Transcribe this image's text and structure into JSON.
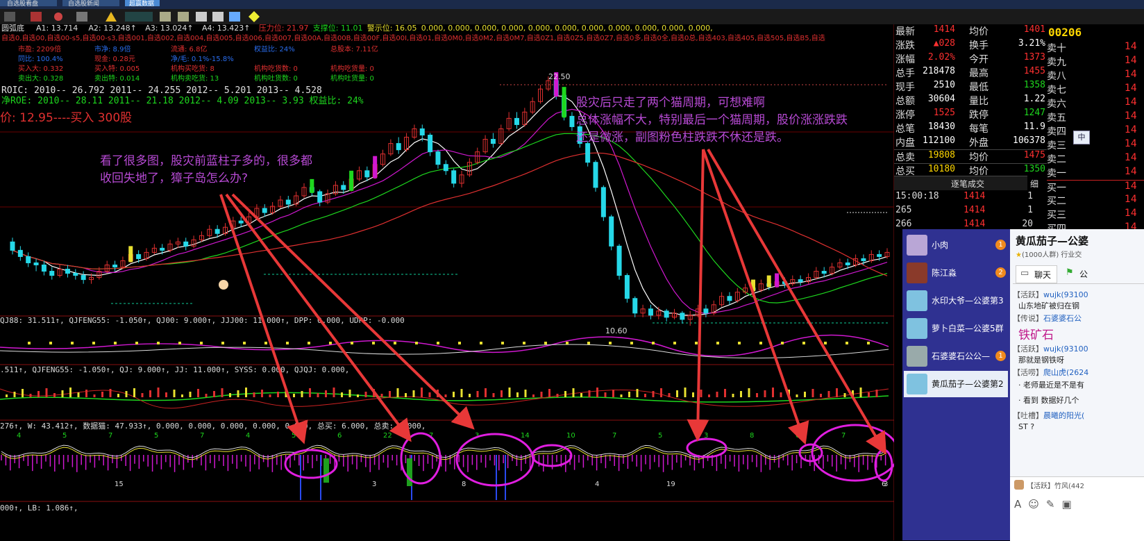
{
  "toolbar": {
    "tabs": [
      "自选股看盘",
      "自选股新闻",
      "超赢数据"
    ],
    "icons": [
      "layout-icon",
      "chart-icon",
      "signal-icon",
      "alarm-icon",
      "stats-icon",
      "drawing-icon",
      "text-icon",
      "chart2-icon",
      "help-icon"
    ]
  },
  "chart_data": {
    "type": "candlestick",
    "indicator_top": {
      "name": "圆弧底",
      "items": [
        {
          "label": "A1:",
          "value": "13.714"
        },
        {
          "label": "A2:",
          "value": "13.248↑"
        },
        {
          "label": "A3:",
          "value": "13.024↑"
        },
        {
          "label": "A4:",
          "value": "13.423↑"
        },
        {
          "label": "压力位:",
          "value": "21.97"
        },
        {
          "label": "支撑位:",
          "value": "11.01"
        },
        {
          "label": "警示位:",
          "value": "16.05"
        },
        {
          "label": "",
          "value": "0.000, 0.000, 0.000, 0.000, 0.000, 0.000, 0.000, 0.000, 0.000, 0.000, 0.000,"
        }
      ]
    },
    "selection_line": "自选0,自选00,自选00-s5,自选00-s3,自选001,自选002,自选004,自选005,自选006,自选007,自选00A,自选00B,自选00F,自选00I,自选01,自选0M0,自选0M2,自选0M7,自选0Z1,自选0Z5,自选0Z7,自选0多,自选0全,自选0总,自选403,自选405,自选505,自选B5,自选",
    "fundamentals": [
      [
        "市盈: 2209倍",
        "市净: 8.9倍",
        "流通: 6.8亿",
        "权益比: 24%",
        "总股本: 7.11亿"
      ],
      [
        "同比: 100.4%",
        "现金: 0.28元",
        "净/毛: 0.1%-15.8%"
      ],
      [
        "买入大: 0.332",
        "买入特: 0.005",
        "机构买吃货: 8",
        "机构吃货数: 0",
        "机构吃货量: 0"
      ],
      [
        "卖出大: 0.328",
        "卖出特: 0.014",
        "机构卖吃货: 13",
        "机构吐货数: 0",
        "机构吐货量: 0"
      ]
    ],
    "roic": "ROIC: 2010-- 26.792    2011-- 24.255    2012-- 5.201    2013-- 4.528",
    "roe": "净ROE: 2010-- 28.11     2011-- 21.18     2012-- 4.09     2013-- 3.93     权益比: 24%",
    "buy_note": "价: 12.95----买入 300股",
    "price_high": "22.50",
    "price_low": "10.60",
    "candles": [
      [
        14.6,
        14.2,
        14.8,
        14.0
      ],
      [
        14.2,
        13.9,
        14.4,
        13.7
      ],
      [
        13.9,
        13.6,
        14.1,
        13.4
      ],
      [
        13.6,
        13.5,
        13.8,
        13.2
      ],
      [
        13.5,
        13.2,
        13.7,
        13.0
      ],
      [
        13.2,
        13.0,
        13.4,
        12.8
      ],
      [
        13.0,
        13.3,
        13.5,
        12.9
      ],
      [
        13.3,
        13.1,
        13.5,
        12.9
      ],
      [
        13.1,
        13.0,
        13.3,
        12.8
      ],
      [
        13.0,
        12.8,
        13.2,
        12.6
      ],
      [
        12.8,
        12.9,
        13.1,
        12.6
      ],
      [
        12.9,
        13.2,
        13.4,
        12.8
      ],
      [
        13.2,
        13.5,
        13.7,
        13.1
      ],
      [
        13.5,
        13.4,
        13.7,
        13.2
      ],
      [
        13.4,
        13.7,
        13.9,
        13.3
      ],
      [
        13.7,
        14.0,
        14.2,
        13.6
      ],
      [
        14.0,
        13.8,
        14.2,
        13.6
      ],
      [
        13.8,
        14.1,
        14.3,
        13.7
      ],
      [
        14.1,
        14.3,
        14.5,
        14.0
      ],
      [
        14.3,
        14.2,
        14.5,
        14.0
      ],
      [
        14.2,
        14.5,
        14.7,
        14.1
      ],
      [
        14.5,
        14.6,
        14.8,
        14.3
      ],
      [
        14.6,
        14.4,
        14.8,
        14.2
      ],
      [
        14.4,
        14.7,
        14.9,
        14.3
      ],
      [
        14.7,
        14.9,
        15.1,
        14.6
      ],
      [
        14.9,
        15.2,
        15.4,
        14.8
      ],
      [
        15.2,
        15.0,
        15.4,
        14.8
      ],
      [
        15.0,
        15.3,
        15.5,
        14.9
      ],
      [
        15.3,
        15.6,
        15.8,
        15.2
      ],
      [
        15.6,
        15.5,
        15.8,
        15.3
      ],
      [
        15.5,
        15.8,
        16.0,
        15.4
      ],
      [
        15.8,
        16.2,
        16.4,
        15.7
      ],
      [
        16.2,
        16.0,
        16.4,
        15.8
      ],
      [
        16.0,
        16.3,
        16.5,
        15.9
      ],
      [
        16.3,
        16.6,
        16.8,
        16.2
      ],
      [
        16.6,
        16.4,
        16.8,
        16.2
      ],
      [
        16.4,
        16.8,
        17.0,
        16.3
      ],
      [
        16.8,
        17.2,
        17.4,
        16.7
      ],
      [
        17.2,
        17.0,
        17.4,
        16.8
      ],
      [
        17.0,
        16.5,
        17.1,
        16.3
      ],
      [
        16.5,
        16.9,
        17.1,
        16.4
      ],
      [
        16.9,
        17.3,
        17.5,
        16.8
      ],
      [
        17.3,
        17.1,
        17.5,
        16.9
      ],
      [
        17.1,
        17.6,
        17.8,
        17.0
      ],
      [
        17.6,
        18.0,
        18.2,
        17.5
      ],
      [
        18.0,
        17.7,
        18.2,
        17.5
      ],
      [
        17.7,
        18.3,
        18.5,
        17.6
      ],
      [
        18.3,
        18.8,
        19.0,
        18.2
      ],
      [
        18.8,
        19.3,
        19.5,
        18.7
      ],
      [
        19.3,
        19.0,
        19.6,
        18.8
      ],
      [
        19.0,
        19.6,
        19.8,
        18.9
      ],
      [
        19.6,
        20.0,
        20.2,
        19.5
      ],
      [
        20.0,
        19.7,
        20.2,
        19.4
      ],
      [
        19.7,
        18.9,
        19.8,
        18.7
      ],
      [
        18.9,
        18.3,
        19.0,
        18.1
      ],
      [
        18.3,
        18.0,
        18.5,
        17.8
      ],
      [
        18.0,
        17.4,
        18.1,
        17.2
      ],
      [
        17.4,
        17.8,
        18.0,
        17.2
      ],
      [
        17.8,
        18.4,
        18.6,
        17.7
      ],
      [
        18.4,
        18.9,
        19.1,
        18.3
      ],
      [
        18.9,
        19.5,
        19.7,
        18.8
      ],
      [
        19.5,
        19.3,
        19.8,
        19.1
      ],
      [
        19.3,
        20.0,
        20.2,
        19.2
      ],
      [
        20.0,
        20.5,
        20.8,
        19.9
      ],
      [
        20.5,
        20.2,
        20.8,
        20.0
      ],
      [
        20.2,
        20.8,
        21.0,
        20.1
      ],
      [
        20.8,
        21.3,
        21.5,
        20.7
      ],
      [
        21.3,
        21.9,
        22.1,
        21.2
      ],
      [
        21.9,
        22.3,
        22.5,
        21.8
      ],
      [
        22.3,
        21.6,
        22.5,
        21.4
      ],
      [
        21.6,
        20.6,
        21.7,
        20.4
      ],
      [
        20.6,
        20.1,
        20.8,
        19.9
      ],
      [
        20.1,
        19.3,
        20.2,
        19.1
      ],
      [
        19.3,
        18.4,
        19.4,
        18.2
      ],
      [
        18.4,
        17.2,
        18.5,
        17.0
      ],
      [
        17.2,
        15.8,
        17.3,
        15.6
      ],
      [
        15.8,
        14.4,
        15.9,
        14.2
      ],
      [
        14.4,
        13.0,
        14.5,
        12.8
      ],
      [
        13.0,
        11.9,
        13.1,
        11.7
      ],
      [
        11.9,
        11.2,
        12.0,
        11.0
      ],
      [
        11.2,
        11.4,
        11.6,
        11.0
      ],
      [
        11.4,
        11.1,
        11.6,
        10.9
      ],
      [
        11.1,
        11.3,
        11.5,
        10.9
      ],
      [
        11.3,
        11.0,
        11.4,
        10.8
      ],
      [
        11.0,
        11.2,
        11.4,
        10.9
      ],
      [
        11.2,
        10.9,
        11.3,
        10.7
      ],
      [
        10.9,
        11.1,
        11.3,
        10.6
      ],
      [
        11.1,
        11.4,
        11.6,
        11.0
      ],
      [
        11.4,
        11.2,
        11.6,
        11.0
      ],
      [
        11.2,
        11.6,
        11.8,
        11.1
      ],
      [
        11.6,
        12.0,
        12.2,
        11.5
      ],
      [
        12.0,
        11.8,
        12.2,
        11.6
      ],
      [
        11.8,
        12.2,
        12.4,
        11.7
      ],
      [
        12.2,
        12.4,
        12.6,
        12.1
      ],
      [
        12.4,
        12.3,
        12.6,
        12.1
      ],
      [
        12.3,
        12.6,
        12.8,
        12.2
      ],
      [
        12.6,
        12.5,
        12.8,
        12.3
      ],
      [
        12.5,
        12.7,
        12.9,
        12.4
      ],
      [
        12.7,
        12.6,
        12.9,
        12.4
      ],
      [
        12.6,
        12.8,
        13.0,
        12.5
      ],
      [
        12.8,
        12.7,
        13.0,
        12.5
      ],
      [
        12.7,
        12.9,
        13.1,
        12.6
      ],
      [
        12.9,
        13.2,
        13.4,
        12.8
      ],
      [
        13.2,
        13.1,
        13.4,
        12.9
      ],
      [
        13.1,
        13.4,
        13.6,
        13.0
      ],
      [
        13.4,
        13.6,
        13.8,
        13.3
      ],
      [
        13.6,
        13.5,
        13.8,
        13.3
      ],
      [
        13.5,
        13.8,
        14.0,
        13.4
      ],
      [
        13.8,
        13.7,
        14.0,
        13.5
      ],
      [
        13.7,
        14.0,
        14.2,
        13.6
      ],
      [
        14.0,
        13.9,
        14.2,
        13.7
      ],
      [
        13.9,
        14.1,
        14.3,
        13.8
      ]
    ],
    "annotations": {
      "left": [
        "看了很多图，股灾前蓝柱子多的，很多都",
        "收回失地了，獐子岛怎么办?"
      ],
      "right": [
        "股灾后只走了两个猫周期，可想难啊",
        "总体涨幅不大，特别最后一个猫周期，股价涨涨跌跌",
        "还是微涨，副图粉色柱跌跌不休还是跌。"
      ]
    },
    "sub1": "QJ88: 31.511↑, QJFENG55: -1.050↑, QJ00: 9.000↑, JJJ00: 11.000↑, DPP: 0.000, UDPP: -0.000",
    "sub2": ".511↑, QJFENG55: -1.050↑, QJ: 9.000↑, JJ: 11.000↑, SYSS: 0.000, QJQJ: 0.000,",
    "sub3": "276↑, W: 43.412↑, 数据猫: 47.933↑, 0.000, 0.000, 0.000, 0.000, 0.000, 总买: 6.000, 总卖: 0.000,",
    "sub4": "000↑, LB: 1.086↑,",
    "cycle_numbers": [
      "4",
      "5",
      "7",
      "5",
      "7",
      "4",
      "5",
      "6",
      "22",
      "7",
      "3",
      "14",
      "10",
      "7",
      "5",
      "3",
      "8",
      "6",
      "7"
    ],
    "bottom_numbers": [
      "15",
      "3",
      "8",
      "4",
      "19",
      "3",
      "6"
    ]
  },
  "quote": {
    "code": "00206",
    "rows": [
      {
        "l1": "最新",
        "v1": "1414",
        "l2": "均价",
        "v2": "1401"
      },
      {
        "l1": "涨跌",
        "v1": "▲028",
        "l2": "换手",
        "v2": "3.21%"
      },
      {
        "l1": "涨幅",
        "v1": "2.02%",
        "l2": "今开",
        "v2": "1373"
      },
      {
        "l1": "总手",
        "v1": "218478",
        "l2": "最高",
        "v2": "1455"
      },
      {
        "l1": "现手",
        "v1": "2510",
        "l2": "最低",
        "v2": "1358"
      },
      {
        "l1": "总额",
        "v1": "30604",
        "l2": "量比",
        "v2": "1.22"
      },
      {
        "l1": "涨停",
        "v1": "1525",
        "l2": "跌停",
        "v2": "1247"
      },
      {
        "l1": "总笔",
        "v1": "18430",
        "l2": "每笔",
        "v2": "11.9"
      },
      {
        "l1": "内盘",
        "v1": "112100",
        "l2": "外盘",
        "v2": "106378"
      },
      {
        "l1": "总卖",
        "v1": "19808",
        "l2": "均价",
        "v2": "1475"
      },
      {
        "l1": "总买",
        "v1": "10180",
        "l2": "均价",
        "v2": "1350"
      }
    ],
    "sell_levels": [
      "卖十",
      "卖九",
      "卖八",
      "卖七",
      "卖六",
      "卖五",
      "卖四",
      "卖三",
      "卖二",
      "卖一"
    ],
    "buy_levels": [
      "买一",
      "买二",
      "买三",
      "买四"
    ],
    "level_prices": [
      "14",
      "14",
      "14",
      "14",
      "14",
      "14",
      "14",
      "14",
      "14",
      "14",
      "14",
      "14",
      "14",
      "14"
    ],
    "trades_title": "逐笔成交",
    "trades_btn": "细",
    "trades": [
      {
        "time": "15:00:18",
        "price": "1414",
        "vol": "1"
      },
      {
        "time": "265",
        "price": "1414",
        "vol": "1"
      },
      {
        "time": "266",
        "price": "1414",
        "vol": "20"
      }
    ]
  },
  "chat": {
    "contacts": [
      {
        "name": "小肉",
        "badge": "1"
      },
      {
        "name": "陈江淼",
        "badge": "2"
      },
      {
        "name": "水印大爷—公婆第3",
        "badge": ""
      },
      {
        "name": "萝卜白菜—公婆5群",
        "badge": ""
      },
      {
        "name": "石婆婆石公公—",
        "badge": "1"
      },
      {
        "name": "黄瓜茄子—公婆第2",
        "badge": ""
      }
    ],
    "group_title": "黄瓜茄子—公婆",
    "group_sub": "(1000人群) 行业交",
    "tab_chat": "聊天",
    "tab_notice": "公",
    "messages": [
      {
        "tag": "【活跃】",
        "user": "wujk(93100",
        "text": "山东地矿被归在钢"
      },
      {
        "tag": "【传说】",
        "user": "石婆婆石公",
        "text": ""
      },
      {
        "tag": "",
        "user": "",
        "text": "铁矿石"
      },
      {
        "tag": "【活跃】",
        "user": "wujk(93100",
        "text": "那就是钢铁呀"
      },
      {
        "tag": "【活唠】",
        "user": "爬山虎(2624",
        "text": ""
      },
      {
        "tag": "",
        "user": "",
        "text": "· 老师最近是不是有"
      },
      {
        "tag": "",
        "user": "",
        "text": "· 看到 数据好几个"
      },
      {
        "tag": "【吐槽】",
        "user": "晨曦的阳光(",
        "text": ""
      },
      {
        "tag": "",
        "user": "",
        "text": "ST ?"
      }
    ],
    "input_user": "【活跃】竹风(442",
    "input_icons": [
      "font-icon",
      "emoji-icon",
      "tools-icon",
      "screenshot-icon"
    ]
  },
  "side_popup": "中"
}
